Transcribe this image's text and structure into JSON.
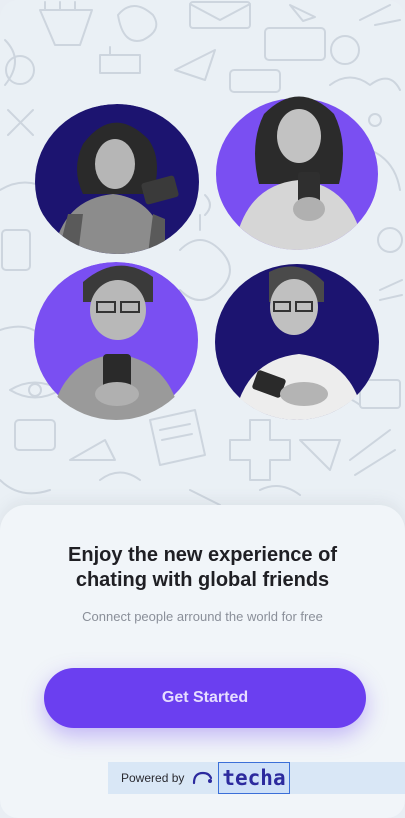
{
  "onboarding": {
    "headline_line1": "Enjoy the new experience of",
    "headline_line2": "chating with global friends",
    "subtitle": "Connect people arround the world for free",
    "cta_label": "Get Started"
  },
  "footer": {
    "powered_by": "Powered by",
    "brand": "techa"
  },
  "colors": {
    "accent": "#6b3ff0",
    "navy": "#1c1470",
    "violet": "#7a4ff2",
    "background": "#eaf0f5"
  }
}
